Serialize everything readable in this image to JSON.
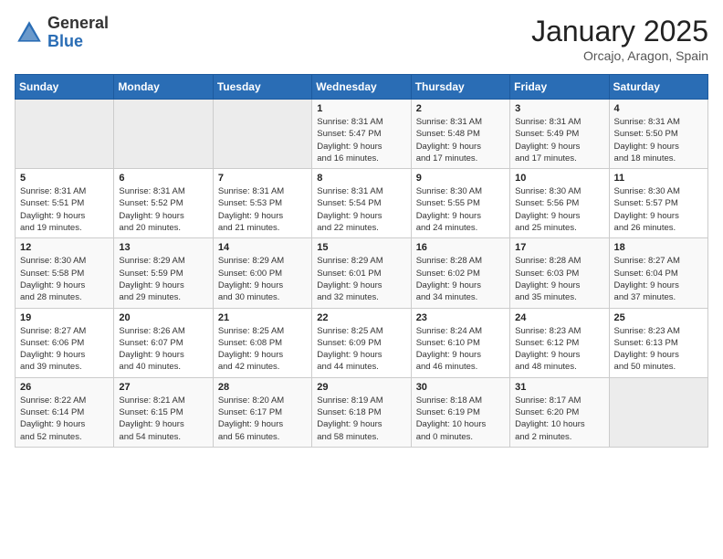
{
  "header": {
    "logo_general": "General",
    "logo_blue": "Blue",
    "month": "January 2025",
    "location": "Orcajo, Aragon, Spain"
  },
  "weekdays": [
    "Sunday",
    "Monday",
    "Tuesday",
    "Wednesday",
    "Thursday",
    "Friday",
    "Saturday"
  ],
  "weeks": [
    [
      {
        "day": "",
        "info": ""
      },
      {
        "day": "",
        "info": ""
      },
      {
        "day": "",
        "info": ""
      },
      {
        "day": "1",
        "info": "Sunrise: 8:31 AM\nSunset: 5:47 PM\nDaylight: 9 hours\nand 16 minutes."
      },
      {
        "day": "2",
        "info": "Sunrise: 8:31 AM\nSunset: 5:48 PM\nDaylight: 9 hours\nand 17 minutes."
      },
      {
        "day": "3",
        "info": "Sunrise: 8:31 AM\nSunset: 5:49 PM\nDaylight: 9 hours\nand 17 minutes."
      },
      {
        "day": "4",
        "info": "Sunrise: 8:31 AM\nSunset: 5:50 PM\nDaylight: 9 hours\nand 18 minutes."
      }
    ],
    [
      {
        "day": "5",
        "info": "Sunrise: 8:31 AM\nSunset: 5:51 PM\nDaylight: 9 hours\nand 19 minutes."
      },
      {
        "day": "6",
        "info": "Sunrise: 8:31 AM\nSunset: 5:52 PM\nDaylight: 9 hours\nand 20 minutes."
      },
      {
        "day": "7",
        "info": "Sunrise: 8:31 AM\nSunset: 5:53 PM\nDaylight: 9 hours\nand 21 minutes."
      },
      {
        "day": "8",
        "info": "Sunrise: 8:31 AM\nSunset: 5:54 PM\nDaylight: 9 hours\nand 22 minutes."
      },
      {
        "day": "9",
        "info": "Sunrise: 8:30 AM\nSunset: 5:55 PM\nDaylight: 9 hours\nand 24 minutes."
      },
      {
        "day": "10",
        "info": "Sunrise: 8:30 AM\nSunset: 5:56 PM\nDaylight: 9 hours\nand 25 minutes."
      },
      {
        "day": "11",
        "info": "Sunrise: 8:30 AM\nSunset: 5:57 PM\nDaylight: 9 hours\nand 26 minutes."
      }
    ],
    [
      {
        "day": "12",
        "info": "Sunrise: 8:30 AM\nSunset: 5:58 PM\nDaylight: 9 hours\nand 28 minutes."
      },
      {
        "day": "13",
        "info": "Sunrise: 8:29 AM\nSunset: 5:59 PM\nDaylight: 9 hours\nand 29 minutes."
      },
      {
        "day": "14",
        "info": "Sunrise: 8:29 AM\nSunset: 6:00 PM\nDaylight: 9 hours\nand 30 minutes."
      },
      {
        "day": "15",
        "info": "Sunrise: 8:29 AM\nSunset: 6:01 PM\nDaylight: 9 hours\nand 32 minutes."
      },
      {
        "day": "16",
        "info": "Sunrise: 8:28 AM\nSunset: 6:02 PM\nDaylight: 9 hours\nand 34 minutes."
      },
      {
        "day": "17",
        "info": "Sunrise: 8:28 AM\nSunset: 6:03 PM\nDaylight: 9 hours\nand 35 minutes."
      },
      {
        "day": "18",
        "info": "Sunrise: 8:27 AM\nSunset: 6:04 PM\nDaylight: 9 hours\nand 37 minutes."
      }
    ],
    [
      {
        "day": "19",
        "info": "Sunrise: 8:27 AM\nSunset: 6:06 PM\nDaylight: 9 hours\nand 39 minutes."
      },
      {
        "day": "20",
        "info": "Sunrise: 8:26 AM\nSunset: 6:07 PM\nDaylight: 9 hours\nand 40 minutes."
      },
      {
        "day": "21",
        "info": "Sunrise: 8:25 AM\nSunset: 6:08 PM\nDaylight: 9 hours\nand 42 minutes."
      },
      {
        "day": "22",
        "info": "Sunrise: 8:25 AM\nSunset: 6:09 PM\nDaylight: 9 hours\nand 44 minutes."
      },
      {
        "day": "23",
        "info": "Sunrise: 8:24 AM\nSunset: 6:10 PM\nDaylight: 9 hours\nand 46 minutes."
      },
      {
        "day": "24",
        "info": "Sunrise: 8:23 AM\nSunset: 6:12 PM\nDaylight: 9 hours\nand 48 minutes."
      },
      {
        "day": "25",
        "info": "Sunrise: 8:23 AM\nSunset: 6:13 PM\nDaylight: 9 hours\nand 50 minutes."
      }
    ],
    [
      {
        "day": "26",
        "info": "Sunrise: 8:22 AM\nSunset: 6:14 PM\nDaylight: 9 hours\nand 52 minutes."
      },
      {
        "day": "27",
        "info": "Sunrise: 8:21 AM\nSunset: 6:15 PM\nDaylight: 9 hours\nand 54 minutes."
      },
      {
        "day": "28",
        "info": "Sunrise: 8:20 AM\nSunset: 6:17 PM\nDaylight: 9 hours\nand 56 minutes."
      },
      {
        "day": "29",
        "info": "Sunrise: 8:19 AM\nSunset: 6:18 PM\nDaylight: 9 hours\nand 58 minutes."
      },
      {
        "day": "30",
        "info": "Sunrise: 8:18 AM\nSunset: 6:19 PM\nDaylight: 10 hours\nand 0 minutes."
      },
      {
        "day": "31",
        "info": "Sunrise: 8:17 AM\nSunset: 6:20 PM\nDaylight: 10 hours\nand 2 minutes."
      },
      {
        "day": "",
        "info": ""
      }
    ]
  ]
}
